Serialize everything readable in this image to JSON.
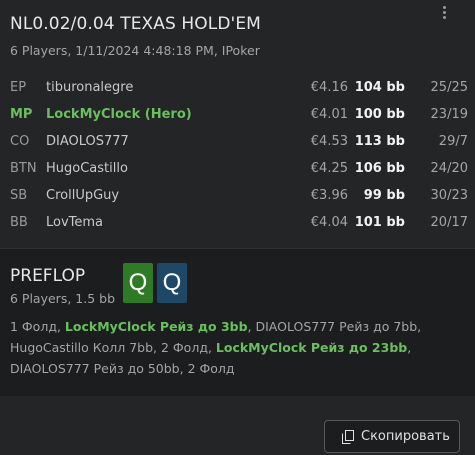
{
  "header": {
    "title": "NL0.02/0.04 TEXAS HOLD'EM",
    "subtitle": "6 Players, 1/11/2024 4:48:18 PM, IPoker"
  },
  "players": [
    {
      "pos": "EP",
      "name": "tiburonalegre",
      "amount": "€4.16",
      "bb": "104 bb",
      "ratio": "25/25"
    },
    {
      "pos": "MP",
      "name": "LockMyClock (Hero)",
      "amount": "€4.01",
      "bb": "100 bb",
      "ratio": "23/19"
    },
    {
      "pos": "CO",
      "name": "DIAOLOS777",
      "amount": "€4.53",
      "bb": "113 bb",
      "ratio": "29/7"
    },
    {
      "pos": "BTN",
      "name": "HugoCastillo",
      "amount": "€4.25",
      "bb": "106 bb",
      "ratio": "24/20"
    },
    {
      "pos": "SB",
      "name": "CrollUpGuy",
      "amount": "€3.96",
      "bb": "99 bb",
      "ratio": "30/23"
    },
    {
      "pos": "BB",
      "name": "LovTema",
      "amount": "€4.04",
      "bb": "101 bb",
      "ratio": "20/17"
    }
  ],
  "street": {
    "name": "PREFLOP",
    "subtitle": "6 Players, 1.5 bb",
    "cards": [
      "Q",
      "Q"
    ],
    "card_colors": [
      "#2e7a27",
      "#1f4767"
    ]
  },
  "actions": {
    "a1": "1 Фолд, ",
    "a2": "LockMyClock Рейз до 3bb",
    "a3": ", DIAOLOS777 Рейз до 7bb, HugoCastillo Колл 7bb, 2 Фолд, ",
    "a4": "LockMyClock Рейз до 23bb",
    "a5": ", DIAOLOS777 Рейз до 50bb, 2 Фолд"
  },
  "footer": {
    "copy_label": "Скопировать"
  },
  "colors": {
    "hero": "#6abf5e",
    "background": "#1c1d1f",
    "panel": "#242527"
  }
}
